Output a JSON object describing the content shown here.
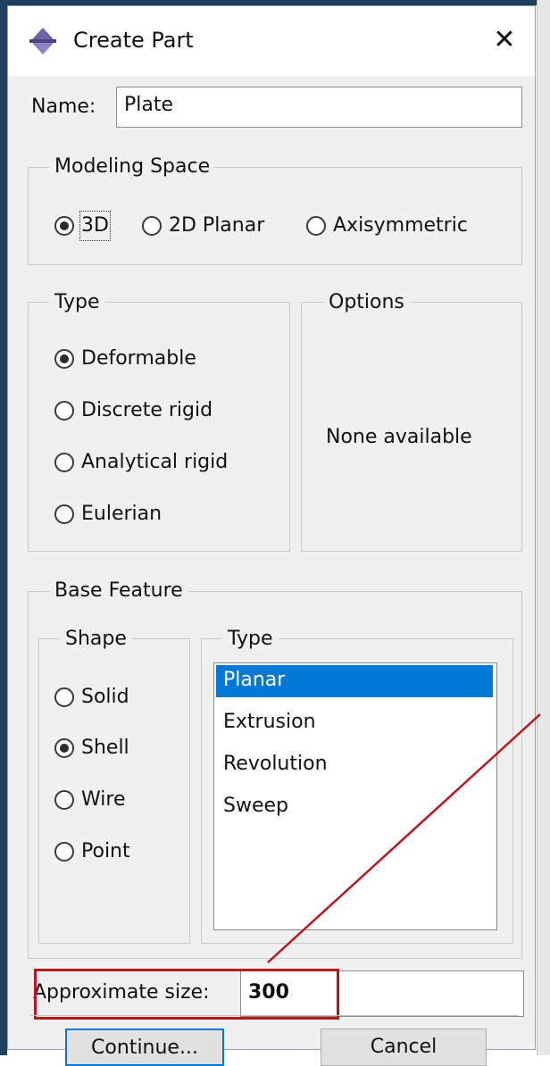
{
  "dialog": {
    "title": "Create Part",
    "title_icon": "abaqus-part-icon",
    "close_icon": "close-icon",
    "close_glyph": "✕"
  },
  "name": {
    "label": "Name:",
    "value": "Plate"
  },
  "modeling_space": {
    "label": "Modeling Space",
    "options": [
      {
        "label": "3D",
        "selected": true
      },
      {
        "label": "2D Planar",
        "selected": false
      },
      {
        "label": "Axisymmetric",
        "selected": false
      }
    ]
  },
  "type": {
    "label": "Type",
    "options": [
      {
        "label": "Deformable",
        "selected": true
      },
      {
        "label": "Discrete rigid",
        "selected": false
      },
      {
        "label": "Analytical rigid",
        "selected": false
      },
      {
        "label": "Eulerian",
        "selected": false
      }
    ]
  },
  "options": {
    "label": "Options",
    "message": "None available"
  },
  "base_feature": {
    "label": "Base Feature",
    "shape": {
      "label": "Shape",
      "options": [
        {
          "label": "Solid",
          "selected": false
        },
        {
          "label": "Shell",
          "selected": true
        },
        {
          "label": "Wire",
          "selected": false
        },
        {
          "label": "Point",
          "selected": false
        }
      ]
    },
    "type": {
      "label": "Type",
      "items": [
        {
          "label": "Planar",
          "selected": true
        },
        {
          "label": "Extrusion",
          "selected": false
        },
        {
          "label": "Revolution",
          "selected": false
        },
        {
          "label": "Sweep",
          "selected": false
        }
      ]
    }
  },
  "approximate_size": {
    "label": "Approximate size:",
    "value": "300"
  },
  "buttons": {
    "continue": "Continue...",
    "cancel": "Cancel"
  },
  "colors": {
    "selection": "#0078d7",
    "callout": "#b5191e",
    "window_frame": "#1f3c5c"
  }
}
